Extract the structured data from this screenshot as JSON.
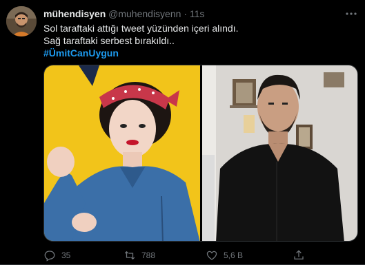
{
  "tweet": {
    "display_name": "mühendisyen",
    "handle": "@muhendisyenn",
    "separator": "·",
    "time": "11s",
    "lines": [
      "Sol taraftaki attığı tweet yüzünden içeri alındı.",
      "Sağ taraftaki serbest bırakıldı.."
    ],
    "hashtag": "#ÜmitCanUygun"
  },
  "actions": {
    "replies": "35",
    "retweets": "788",
    "likes": "5,6 B"
  },
  "icons": {
    "more": "more-icon",
    "reply": "reply-icon",
    "retweet": "retweet-icon",
    "like": "heart-icon",
    "share": "share-icon"
  },
  "colors": {
    "background": "#000000",
    "hashtag": "#1d9bf0",
    "muted": "#71767b",
    "text": "#e7e9ea",
    "poster_yellow": "#f2c41a"
  }
}
